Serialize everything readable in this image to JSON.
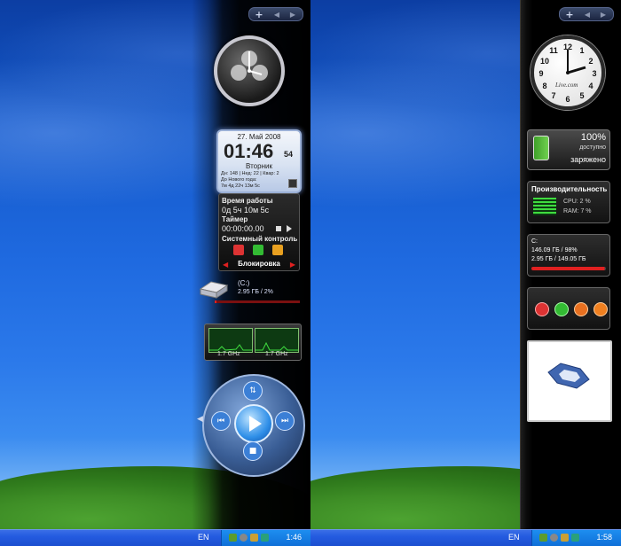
{
  "left": {
    "calendar": {
      "date": "27. Май 2008",
      "time": "01:46",
      "seconds": "54",
      "weekday": "Вторник",
      "stats": "Дн: 148 | Нед: 22 | Квар: 2",
      "newyear_label": "До Нового года:",
      "newyear_values": "7м 4д 22ч 13м 5с"
    },
    "work": {
      "uptime_label": "Время работы",
      "uptime_value": "0д 5ч 10м 5с",
      "timer_label": "Таймер",
      "timer_value": "00:00:00.00",
      "system_label": "Системный контроль",
      "lock_label": "Блокировка"
    },
    "drive": {
      "name": "(C:)",
      "info": "2.95 ГБ / 2%",
      "usage_fraction": 0.02
    },
    "cpu": {
      "core1": "1.7 GHz",
      "core2": "1.7 GHz"
    },
    "taskbar": {
      "lang": "EN",
      "time": "1:46"
    }
  },
  "right": {
    "battery": {
      "percent": "100%",
      "available": "доступно",
      "status": "заряжено"
    },
    "perf": {
      "title": "Производительность",
      "cpu": "CPU: 2 %",
      "ram": "RAM: 7 %"
    },
    "disk": {
      "name": "C:",
      "line1": "146.09 ГБ / 98%",
      "line2": "2.95 ГБ / 149.05 ГБ",
      "usage_fraction": 0.98
    },
    "clock_brand": "Live.com",
    "taskbar": {
      "lang": "EN",
      "time": "1:58"
    }
  },
  "colors": {
    "accent_red": "#e02020",
    "xp_blue": "#245be0",
    "graph_green": "#3fdc3f"
  }
}
